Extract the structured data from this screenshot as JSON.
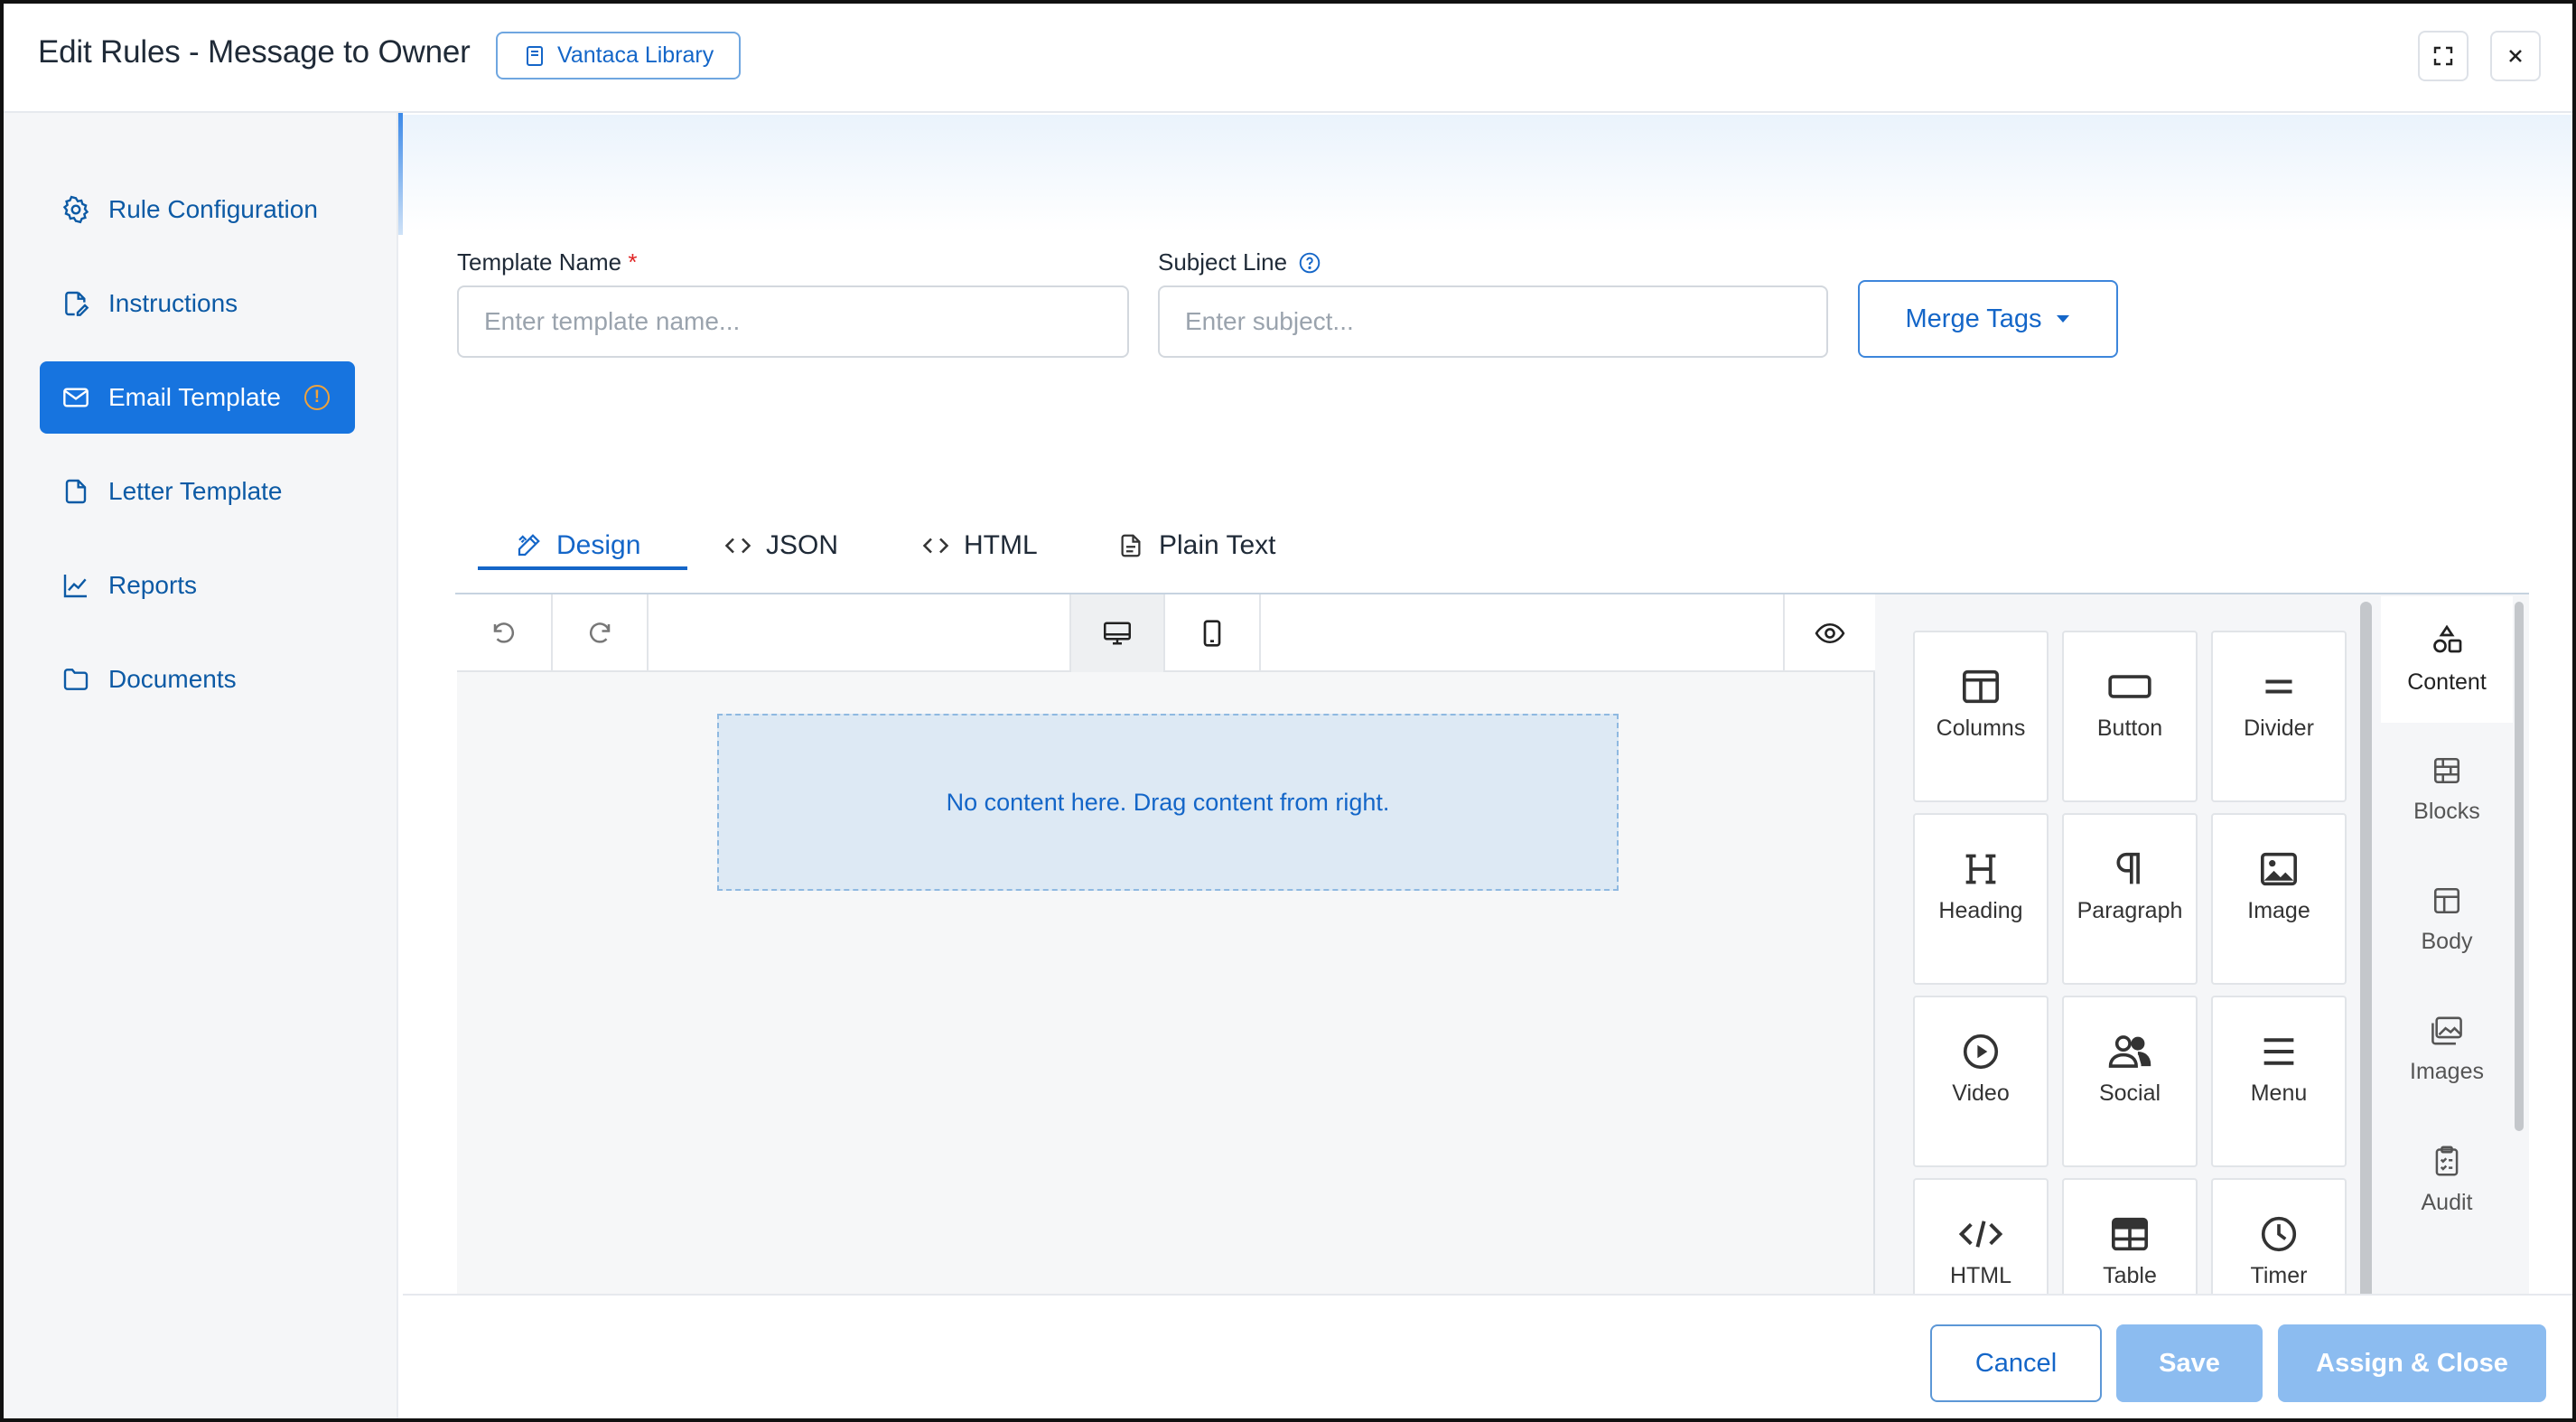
{
  "header": {
    "title": "Edit Rules - Message to Owner",
    "library_button": "Vantaca Library",
    "expand_icon": "expand-icon",
    "close_icon": "close-icon"
  },
  "sidebar": {
    "items": [
      {
        "label": "Rule Configuration",
        "icon": "gear-icon",
        "active": false
      },
      {
        "label": "Instructions",
        "icon": "file-edit-icon",
        "active": false
      },
      {
        "label": "Email Template",
        "icon": "envelope-icon",
        "active": true,
        "warning": "!"
      },
      {
        "label": "Letter Template",
        "icon": "file-icon",
        "active": false
      },
      {
        "label": "Reports",
        "icon": "chart-line-icon",
        "active": false
      },
      {
        "label": "Documents",
        "icon": "folder-icon",
        "active": false
      }
    ]
  },
  "form": {
    "template_name_label": "Template Name",
    "required_mark": "*",
    "template_name_placeholder": "Enter template name...",
    "template_name_value": "",
    "subject_label": "Subject Line",
    "subject_placeholder": "Enter subject...",
    "subject_value": "",
    "merge_tags_label": "Merge Tags"
  },
  "tabs": [
    {
      "label": "Design",
      "active": true
    },
    {
      "label": "JSON",
      "active": false
    },
    {
      "label": "HTML",
      "active": false
    },
    {
      "label": "Plain Text",
      "active": false
    }
  ],
  "editor": {
    "empty_message": "No content here. Drag content from right."
  },
  "content_tools": [
    {
      "label": "Columns",
      "icon": "columns-icon"
    },
    {
      "label": "Button",
      "icon": "button-icon"
    },
    {
      "label": "Divider",
      "icon": "divider-icon"
    },
    {
      "label": "Heading",
      "icon": "heading-icon"
    },
    {
      "label": "Paragraph",
      "icon": "paragraph-icon"
    },
    {
      "label": "Image",
      "icon": "image-icon"
    },
    {
      "label": "Video",
      "icon": "video-icon"
    },
    {
      "label": "Social",
      "icon": "social-icon"
    },
    {
      "label": "Menu",
      "icon": "menu-icon"
    },
    {
      "label": "HTML",
      "icon": "code-icon"
    },
    {
      "label": "Table",
      "icon": "table-icon"
    },
    {
      "label": "Timer",
      "icon": "clock-icon"
    }
  ],
  "panel_tabs": [
    {
      "label": "Content",
      "active": true
    },
    {
      "label": "Blocks",
      "active": false
    },
    {
      "label": "Body",
      "active": false
    },
    {
      "label": "Images",
      "active": false
    },
    {
      "label": "Audit",
      "active": false
    }
  ],
  "footer": {
    "cancel": "Cancel",
    "save": "Save",
    "assign_close": "Assign & Close"
  },
  "colors": {
    "primary": "#1774df",
    "link": "#1466c8",
    "warning": "#f0a23a",
    "disabled_button": "#8cbcf0"
  }
}
